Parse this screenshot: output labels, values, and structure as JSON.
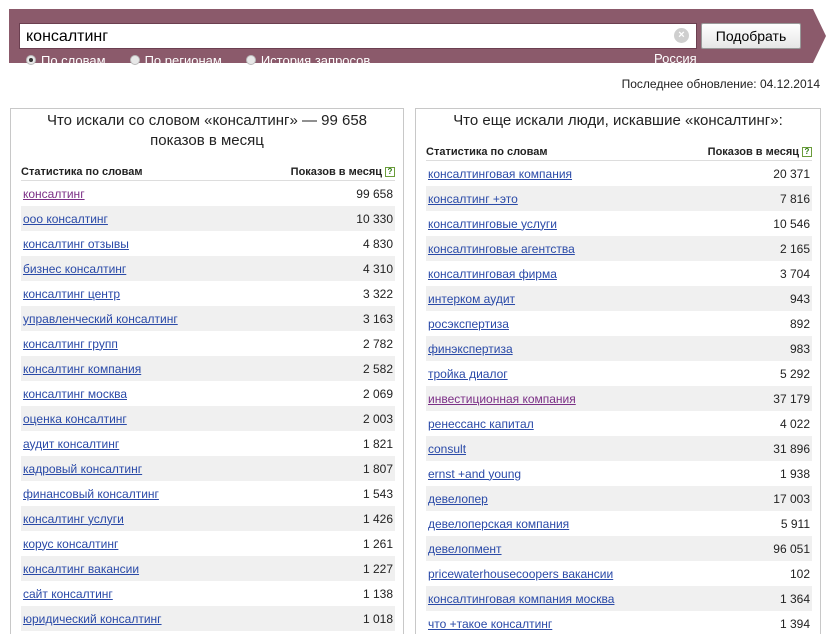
{
  "search": {
    "value": "консалтинг",
    "button_label": "Подобрать",
    "clear_icon": "×"
  },
  "modes": [
    {
      "label": "По словам",
      "selected": true
    },
    {
      "label": "По регионам",
      "selected": false
    },
    {
      "label": "История запросов",
      "selected": false
    }
  ],
  "region": "Россия",
  "last_update": "Последнее обновление: 04.12.2014",
  "left": {
    "title": "Что искали со словом «консалтинг» — 99 658 показов в месяц",
    "col_word": "Статистика по словам",
    "col_count": "Показов в месяц",
    "help": "?",
    "rows": [
      {
        "word": "консалтинг",
        "count": "99 658",
        "visited": true
      },
      {
        "word": "ооо консалтинг",
        "count": "10 330"
      },
      {
        "word": "консалтинг отзывы",
        "count": "4 830"
      },
      {
        "word": "бизнес консалтинг",
        "count": "4 310"
      },
      {
        "word": "консалтинг центр",
        "count": "3 322"
      },
      {
        "word": "управленческий консалтинг",
        "count": "3 163"
      },
      {
        "word": "консалтинг групп",
        "count": "2 782"
      },
      {
        "word": "консалтинг компания",
        "count": "2 582"
      },
      {
        "word": "консалтинг москва",
        "count": "2 069"
      },
      {
        "word": "оценка консалтинг",
        "count": "2 003"
      },
      {
        "word": "аудит консалтинг",
        "count": "1 821"
      },
      {
        "word": "кадровый консалтинг",
        "count": "1 807"
      },
      {
        "word": "финансовый консалтинг",
        "count": "1 543"
      },
      {
        "word": "консалтинг услуги",
        "count": "1 426"
      },
      {
        "word": "корус консалтинг",
        "count": "1 261"
      },
      {
        "word": "консалтинг вакансии",
        "count": "1 227"
      },
      {
        "word": "сайт консалтинг",
        "count": "1 138"
      },
      {
        "word": "юридический консалтинг",
        "count": "1 018"
      }
    ]
  },
  "right": {
    "title": "Что еще искали люди, искавшие «консалтинг»:",
    "col_word": "Статистика по словам",
    "col_count": "Показов в месяц",
    "help": "?",
    "rows": [
      {
        "word": "консалтинговая компания",
        "count": "20 371"
      },
      {
        "word": "консалтинг +это",
        "count": "7 816"
      },
      {
        "word": "консалтинговые услуги",
        "count": "10 546"
      },
      {
        "word": "консалтинговые агентства",
        "count": "2 165"
      },
      {
        "word": "консалтинговая фирма",
        "count": "3 704"
      },
      {
        "word": "интерком аудит",
        "count": "943"
      },
      {
        "word": "росэкспертиза",
        "count": "892"
      },
      {
        "word": "финэкспертиза",
        "count": "983"
      },
      {
        "word": "тройка диалог",
        "count": "5 292"
      },
      {
        "word": "инвестиционная компания",
        "count": "37 179",
        "visited": true
      },
      {
        "word": "ренессанс капитал",
        "count": "4 022"
      },
      {
        "word": "consult",
        "count": "31 896"
      },
      {
        "word": "ernst +and young",
        "count": "1 938"
      },
      {
        "word": "девелопер",
        "count": "17 003"
      },
      {
        "word": "девелоперская компания",
        "count": "5 911"
      },
      {
        "word": "девелопмент",
        "count": "96 051"
      },
      {
        "word": "pricewaterhousecoopers вакансии",
        "count": "102"
      },
      {
        "word": "консалтинговая компания москва",
        "count": "1 364"
      },
      {
        "word": "что +такое консалтинг",
        "count": "1 394"
      }
    ]
  }
}
